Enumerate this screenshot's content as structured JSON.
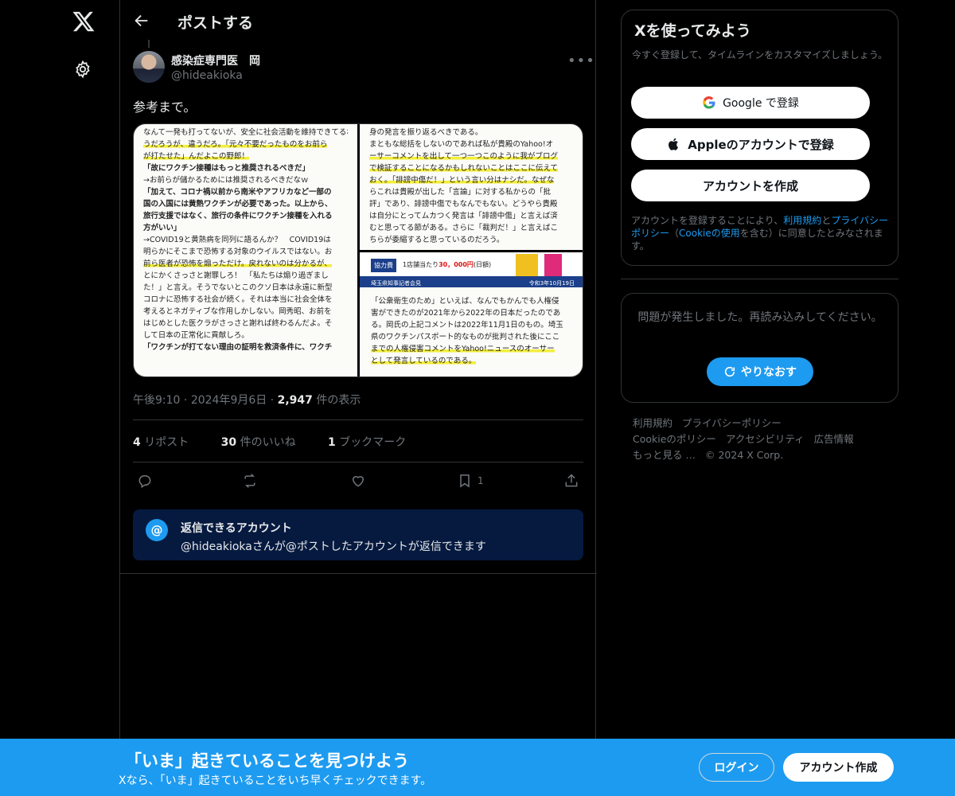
{
  "nav": {
    "logo": "X",
    "settings_icon": "gear-icon"
  },
  "header": {
    "title": "ポストする",
    "back_icon": "arrow-left-icon"
  },
  "post": {
    "author_name": "感染症専門医　岡",
    "author_handle": "@hideakioka",
    "more_icon": "more-horizontal-icon",
    "text": "参考まで。",
    "image_a_lines": [
      "なんて一発も打ってないが、安全に社会活動を維持できてるわ。お前は「打った人に守られているだけ」とか言",
      "うだろうが、違うだろ。「元々不要だったものをお前ら",
      "が打たせた」んだよこの野郎！",
      "「故にワクチン接種はもっと推奨されるべきだ」",
      "→お前らが儲かるためには推奨されるべきだなｗ",
      "「加えて、コロナ禍以前から南米やアフリカなど一部の",
      "国の入国には黄熱ワクチンが必要であった。以上から、",
      "旅行支援ではなく、旅行の条件にワクチン接種を入れる",
      "方がいい」",
      "→COVID19と黄熱病を同列に語るんか？　COVID19は",
      "明らかにそこまで恐怖する対象のウイルスではない。お",
      "前ら医者が恐怖を煽っただけ。戻れないのは分かるが、",
      "とにかくさっさと謝罪しろ！　「私たちは煽り過ぎまし",
      "た！」と言え。そうでないとこのクソ日本は永遠に新型",
      "コロナに恐怖する社会が続く。それは本当に社会全体を",
      "考えるとネガティブな作用しかしない。岡秀昭、お前を",
      "はじめとした医クラがさっさと謝れば終わるんだよ。そ",
      "して日本の正常化に貢献しろ。",
      "「ワクチンが打てない理由の証明を救済条件に、ワクチ"
    ],
    "image_b_lines": [
      "身の発言を振り返るべきである。",
      "まともな総括をしないのであれば私が貴殿のYahoo!オ",
      "ーサーコメントを出して一つ一つこのように我がブログ",
      "で検証することになるかもしれないことはここに伝えて",
      "おく。「誹謗中傷だ！」という言い分はナシだ。なぜな",
      "らこれは貴殿が出した「言論」に対する私からの「批",
      "評」であり、誹謗中傷でもなんでもない。どうやら貴殿",
      "は自分にとってムカつく発言は「誹謗中傷」と言えば済",
      "むと思ってる節がある。さらに「裁判だ！」と言えばこ",
      "ちらが委縮すると思っているのだろう。"
    ],
    "image_c": {
      "tag": "協力費",
      "price_prefix": "1店舗当たり",
      "price": "30，000円",
      "price_suffix": "(日額)",
      "bar_left": "埼玉県知事記者会見",
      "bar_right": "令和3年10月19日",
      "lines": [
        "「公衆衛生のため」といえば、なんでもかんでも人権侵",
        "害ができたのが2021年から2022年の日本だったのであ",
        "る。岡氏の上記コメントは2022年11月1日のもの。埼玉",
        "県のワクチンパスポート的なものが批判された後にここ",
        "までの人権侵害コメントをYahoo!ニュースのオーサー",
        "として発言しているのである。"
      ]
    },
    "time": "午後9:10",
    "date": "2024年9月6日",
    "views_count": "2,947",
    "views_label": "件の表示",
    "reposts_count": "4",
    "reposts_label": "リポスト",
    "likes_count": "30",
    "likes_label": "件のいいね",
    "bookmarks_count": "1",
    "bookmarks_label": "ブックマーク",
    "bookmark_action_count": "1"
  },
  "reply_restriction": {
    "icon": "@",
    "title": "返信できるアカウント",
    "subtitle": "@hideakiokaさんが@ポストしたアカウントが返信できます"
  },
  "signup_card": {
    "title": "Xを使ってみよう",
    "subtitle": "今すぐ登録して、タイムラインをカスタマイズしましょう。",
    "google_label": "Google で登録",
    "apple_label": "Appleのアカウントで登録",
    "create_label": "アカウントを作成",
    "legal_prefix": "アカウントを登録することにより、",
    "terms": "利用規約",
    "legal_and": "と",
    "privacy": "プライバシーポリシー",
    "legal_mid": "（",
    "cookie": "Cookieの使用",
    "legal_suffix": "を含む）に同意したとみなされます。"
  },
  "error_card": {
    "message": "問題が発生しました。再読み込みしてください。",
    "retry_label": "やりなおす"
  },
  "footer_links": [
    "利用規約",
    "プライバシーポリシー",
    "Cookieのポリシー",
    "アクセシビリティ",
    "広告情報",
    "もっと見る …",
    "© 2024 X Corp."
  ],
  "banner": {
    "title": "「いま」起きていることを見つけよう",
    "subtitle": "Xなら、「いま」起きていることをいち早くチェックできます。",
    "login_label": "ログイン",
    "signup_label": "アカウント作成"
  },
  "colors": {
    "accent": "#1d9bf0",
    "background": "#000000",
    "reply_box": "#061a40",
    "muted": "#71767b"
  }
}
